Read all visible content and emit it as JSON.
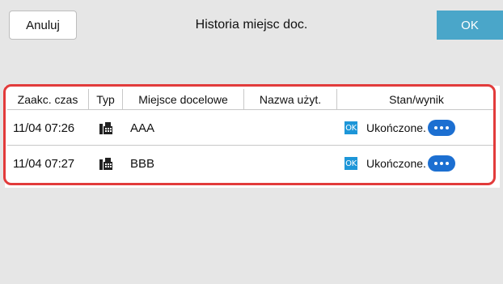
{
  "header": {
    "cancel_label": "Anuluj",
    "title": "Historia miejsc doc.",
    "ok_label": "OK"
  },
  "table": {
    "columns": [
      "Zaakc. czas",
      "Typ",
      "Miejsce docelowe",
      "Nazwa użyt.",
      "Stan/wynik"
    ],
    "rows": [
      {
        "time": "11/04 07:26",
        "type_icon": "fax-icon",
        "destination": "AAA",
        "user": "",
        "status_badge": "OK",
        "status": "Ukończone."
      },
      {
        "time": "11/04 07:27",
        "type_icon": "fax-icon",
        "destination": "BBB",
        "user": "",
        "status_badge": "OK",
        "status": "Ukończone."
      }
    ]
  },
  "colors": {
    "ok_button": "#4aa6c9",
    "highlight_border": "#e23b3b",
    "status_badge": "#1d96d8",
    "more_button": "#1c6fd1"
  }
}
